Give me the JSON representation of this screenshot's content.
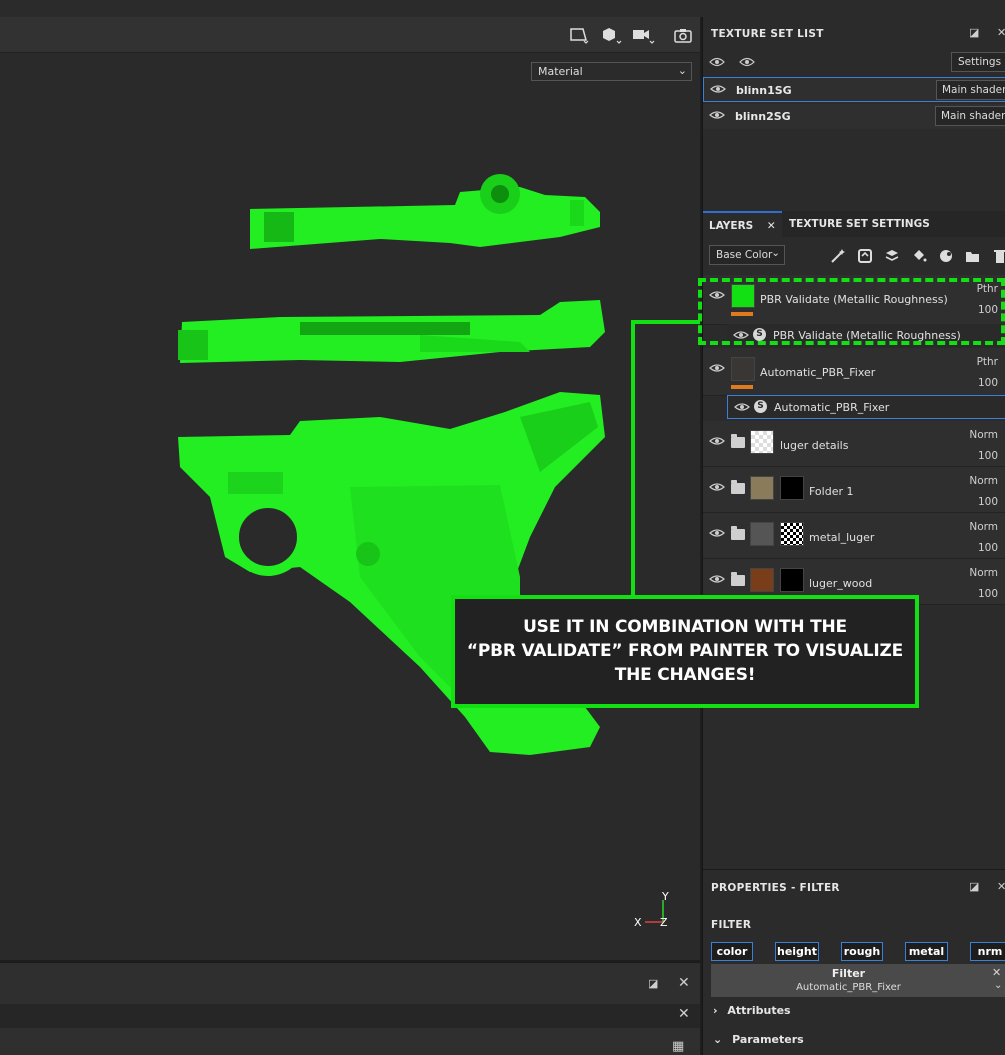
{
  "viewport": {
    "toolbar": {
      "icons": [
        "camera-shape-icon",
        "cube-icon",
        "video-camera-icon",
        "screenshot-camera-icon"
      ]
    },
    "material_select": "Material",
    "axis": {
      "y": "Y",
      "x": "X",
      "z": "Z"
    },
    "colors": {
      "model": "#22ee22",
      "background": "#2a2a2a"
    }
  },
  "texture_set_list": {
    "title": "TEXTURE SET LIST",
    "settings_label": "Settings",
    "sets": [
      {
        "name": "blinn1SG",
        "shader": "Main shader"
      },
      {
        "name": "blinn2SG",
        "shader": "Main shader"
      }
    ]
  },
  "tabs": {
    "layers": "LAYERS",
    "texture_set_settings": "TEXTURE SET SETTINGS"
  },
  "layers": {
    "channel": "Base Color",
    "items": [
      {
        "name": "PBR Validate (Metallic Roughness)",
        "blend": "Pthr",
        "opacity": "100",
        "sub": "PBR Validate (Metallic Roughness)"
      },
      {
        "name": "Automatic_PBR_Fixer",
        "blend": "Pthr",
        "opacity": "100",
        "sub": "Automatic_PBR_Fixer"
      },
      {
        "name": "luger details",
        "blend": "Norm",
        "opacity": "100"
      },
      {
        "name": "Folder 1",
        "blend": "Norm",
        "opacity": "100"
      },
      {
        "name": "metal_luger",
        "blend": "Norm",
        "opacity": "100"
      },
      {
        "name": "luger_wood",
        "blend": "Norm",
        "opacity": "100"
      }
    ]
  },
  "properties": {
    "title": "PROPERTIES - FILTER",
    "filter_heading": "FILTER",
    "channels": [
      "color",
      "height",
      "rough",
      "metal",
      "nrm"
    ],
    "filter_label": "Filter",
    "filter_value": "Automatic_PBR_Fixer",
    "sections": [
      "Attributes",
      "Parameters"
    ]
  },
  "callout": {
    "line1": "USE IT IN COMBINATION WITH THE",
    "line2": "“PBR VALIDATE” FROM PAINTER TO VISUALIZE",
    "line3": "THE CHANGES!"
  }
}
